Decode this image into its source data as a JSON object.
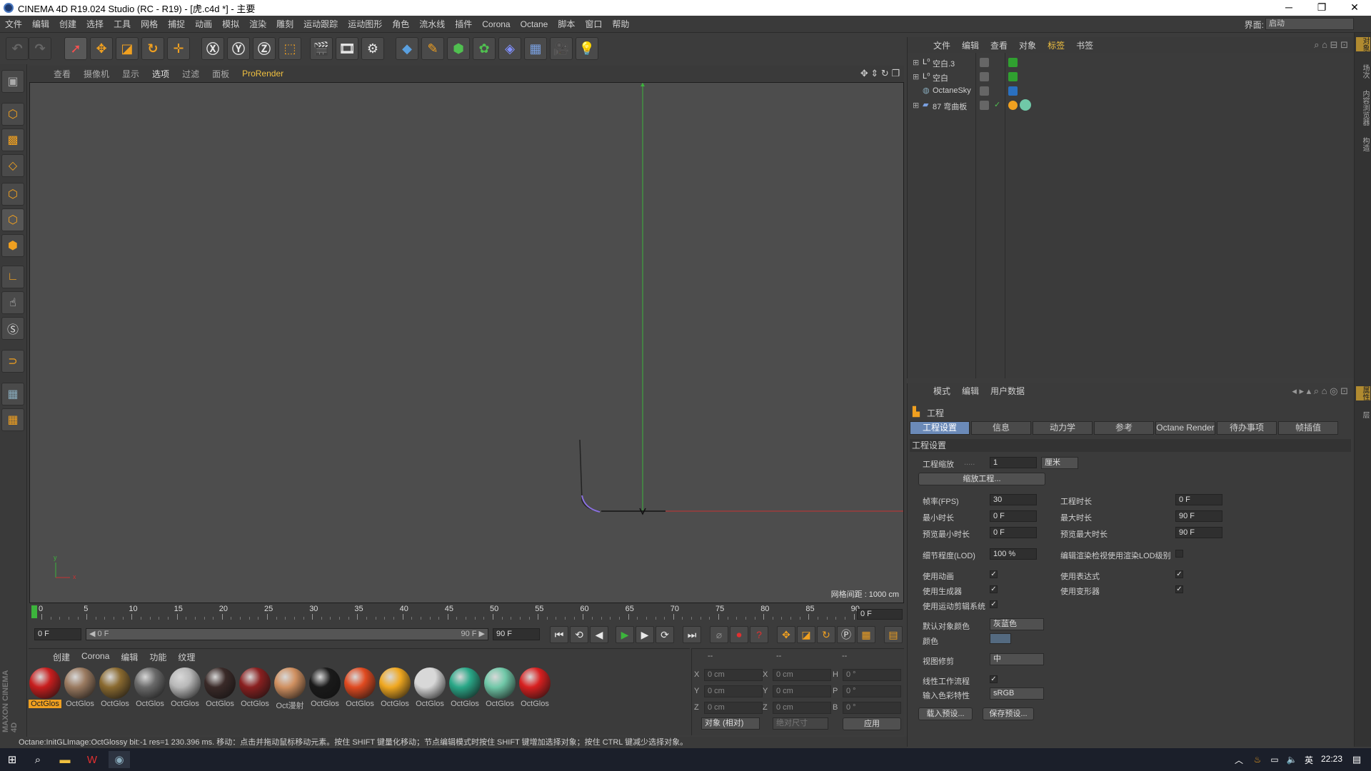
{
  "window": {
    "title": "CINEMA 4D R19.024 Studio (RC - R19) - [虎.c4d *] - 主要",
    "minimize": "─",
    "maximize": "❐",
    "close": "✕"
  },
  "menu": [
    "文件",
    "编辑",
    "创建",
    "选择",
    "工具",
    "网格",
    "捕捉",
    "动画",
    "模拟",
    "渲染",
    "雕刻",
    "运动跟踪",
    "运动图形",
    "角色",
    "流水线",
    "插件",
    "Corona",
    "Octane",
    "脚本",
    "窗口",
    "帮助"
  ],
  "layout": {
    "label": "界面:",
    "value": "启动"
  },
  "viewport": {
    "menu": [
      "查看",
      "摄像机",
      "显示",
      "选项",
      "过滤",
      "面板",
      "ProRender"
    ],
    "grid_label": "网格间距 : 1000 cm",
    "axis_x": "x",
    "axis_y": "y"
  },
  "timeline": {
    "ticks": [
      "0",
      "5",
      "10",
      "15",
      "20",
      "25",
      "30",
      "35",
      "40",
      "45",
      "50",
      "55",
      "60",
      "65",
      "70",
      "75",
      "80",
      "85",
      "90"
    ],
    "current_frame": "0 F",
    "progress": 0
  },
  "playback": {
    "start": "0 F",
    "range_start": "◀ 0 F",
    "range_end": "90 F ▶",
    "end": "90 F"
  },
  "materials": {
    "menu": [
      "创建",
      "Corona",
      "编辑",
      "功能",
      "纹理"
    ],
    "items": [
      {
        "label": "OctGlos",
        "color": "#c81e1e"
      },
      {
        "label": "OctGlos",
        "color": "#9a7a60"
      },
      {
        "label": "OctGlos",
        "color": "#8a6a30"
      },
      {
        "label": "OctGlos",
        "color": "#6a6a6a"
      },
      {
        "label": "OctGlos",
        "color": "#b8b8b8"
      },
      {
        "label": "OctGlos",
        "color": "#3a2a28"
      },
      {
        "label": "OctGlos",
        "color": "#8a2020"
      },
      {
        "label": "Oct漫射",
        "color": "#d09060"
      },
      {
        "label": "OctGlos",
        "color": "#1a1a1a"
      },
      {
        "label": "OctGlos",
        "color": "#e04a20"
      },
      {
        "label": "OctGlos",
        "color": "#f0a820"
      },
      {
        "label": "OctGlos",
        "color": "#d8d8d8"
      },
      {
        "label": "OctGlos",
        "color": "#2aa888"
      },
      {
        "label": "OctGlos",
        "color": "#70c8a8"
      },
      {
        "label": "OctGlos",
        "color": "#d82020"
      }
    ]
  },
  "coords": {
    "headers": [
      "--",
      "--",
      "--"
    ],
    "rows": [
      {
        "a": "X",
        "av": "0 cm",
        "b": "X",
        "bv": "0 cm",
        "c": "H",
        "cv": "0 °"
      },
      {
        "a": "Y",
        "av": "0 cm",
        "b": "Y",
        "bv": "0 cm",
        "c": "P",
        "cv": "0 °"
      },
      {
        "a": "Z",
        "av": "0 cm",
        "b": "Z",
        "bv": "0 cm",
        "c": "B",
        "cv": "0 °"
      }
    ],
    "mode": "对象 (相对)",
    "size_mode": "绝对尺寸",
    "apply": "应用"
  },
  "status": "Octane:InitGLImage:OctGlossy  bit:-1 res=1  230.396 ms.    移动：点击并拖动鼠标移动元素。按住 SHIFT 键量化移动；节点编辑模式时按住 SHIFT 键增加选择对象；按住 CTRL 键减少选择对象。",
  "object_manager": {
    "menu": [
      "文件",
      "编辑",
      "查看",
      "对象",
      "标签",
      "书签"
    ],
    "selected_menu": "标签",
    "objects": [
      {
        "name": "空白.3"
      },
      {
        "name": "空白"
      },
      {
        "name": "OctaneSky"
      },
      {
        "name": "87 弯曲板"
      }
    ]
  },
  "attributes": {
    "menu": [
      "模式",
      "编辑",
      "用户数据"
    ],
    "title": "工程",
    "tabs": [
      "工程设置",
      "信息",
      "动力学",
      "参考",
      "Octane Render",
      "待办事项",
      "帧插值"
    ],
    "section": "工程设置",
    "scale_label": "工程缩放",
    "scale_value": "1",
    "scale_unit": "厘米",
    "scale_button": "缩放工程...",
    "fps_label": "帧率(FPS)",
    "fps": "30",
    "min_label": "最小时长",
    "min": "0 F",
    "pmin_label": "预览最小时长",
    "pmin": "0 F",
    "time_label": "工程时长",
    "time": "0 F",
    "max_label": "最大时长",
    "max": "90 F",
    "pmax_label": "预览最大时长",
    "pmax": "90 F",
    "lod_label": "细节程度(LOD)",
    "lod": "100 %",
    "lod_render_label": "编辑渲染检视使用渲染LOD级别",
    "use_anim": "使用动画",
    "use_gen": "使用生成器",
    "use_mograph": "使用运动剪辑系统",
    "use_expr": "使用表达式",
    "use_deform": "使用变形器",
    "default_color_label": "默认对象颜色",
    "default_color": "灰蓝色",
    "color_label": "颜色",
    "clip_label": "视图修剪",
    "clip": "中",
    "linear_label": "线性工作流程",
    "input_color_label": "输入色彩特性",
    "input_color": "sRGB",
    "load_preset": "载入预设...",
    "save_preset": "保存预设..."
  },
  "side_tabs": [
    "对象",
    "场次",
    "内容浏览器",
    "构造"
  ],
  "side_tabs2": [
    "属性",
    "层"
  ],
  "taskbar": {
    "time": "22:23"
  },
  "colors": {
    "accent": "#f0a020",
    "x_axis": "#c83232",
    "y_axis": "#3cb43c",
    "tab_active": "#6b8ab8"
  }
}
